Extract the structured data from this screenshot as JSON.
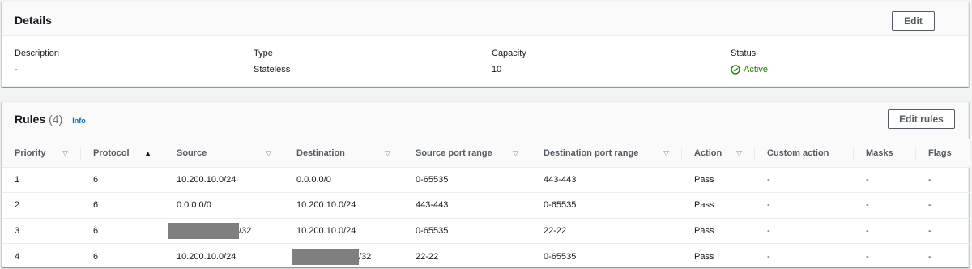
{
  "details": {
    "title": "Details",
    "edit_label": "Edit",
    "fields": [
      {
        "label": "Description",
        "value": "-"
      },
      {
        "label": "Type",
        "value": "Stateless"
      },
      {
        "label": "Capacity",
        "value": "10"
      },
      {
        "label": "Status",
        "value": "Active"
      }
    ]
  },
  "rules": {
    "title": "Rules",
    "count": "(4)",
    "info_label": "Info",
    "edit_label": "Edit rules",
    "columns": [
      {
        "label": "Priority",
        "sort": "none"
      },
      {
        "label": "Protocol",
        "sort": "asc"
      },
      {
        "label": "Source",
        "sort": "none"
      },
      {
        "label": "Destination",
        "sort": "none"
      },
      {
        "label": "Source port range",
        "sort": "none"
      },
      {
        "label": "Destination port range",
        "sort": "none"
      },
      {
        "label": "Action",
        "sort": "none"
      },
      {
        "label": "Custom action",
        "sort": ""
      },
      {
        "label": "Masks",
        "sort": ""
      },
      {
        "label": "Flags",
        "sort": ""
      }
    ],
    "rows": [
      {
        "priority": "1",
        "protocol": "6",
        "source": "10.200.10.0/24",
        "destination": "0.0.0.0/0",
        "src_ports": "0-65535",
        "dst_ports": "443-443",
        "action": "Pass",
        "custom_action": "-",
        "masks": "-",
        "flags": "-"
      },
      {
        "priority": "2",
        "protocol": "6",
        "source": "0.0.0.0/0",
        "destination": "10.200.10.0/24",
        "src_ports": "443-443",
        "dst_ports": "0-65535",
        "action": "Pass",
        "custom_action": "-",
        "masks": "-",
        "flags": "-"
      },
      {
        "priority": "3",
        "protocol": "6",
        "source": "/32",
        "destination": "10.200.10.0/24",
        "src_ports": "0-65535",
        "dst_ports": "22-22",
        "action": "Pass",
        "custom_action": "-",
        "masks": "-",
        "flags": "-"
      },
      {
        "priority": "4",
        "protocol": "6",
        "source": "10.200.10.0/24",
        "destination": "/32",
        "src_ports": "22-22",
        "dst_ports": "0-65535",
        "action": "Pass",
        "custom_action": "-",
        "masks": "-",
        "flags": "-"
      }
    ]
  },
  "colors": {
    "active": "#1d8102",
    "link": "#0073bb",
    "redaction": "#7f7f7f"
  },
  "icons": {
    "status": "check-circle-icon",
    "sort_default": "caret-down-icon",
    "sort_active": "caret-up-icon"
  }
}
